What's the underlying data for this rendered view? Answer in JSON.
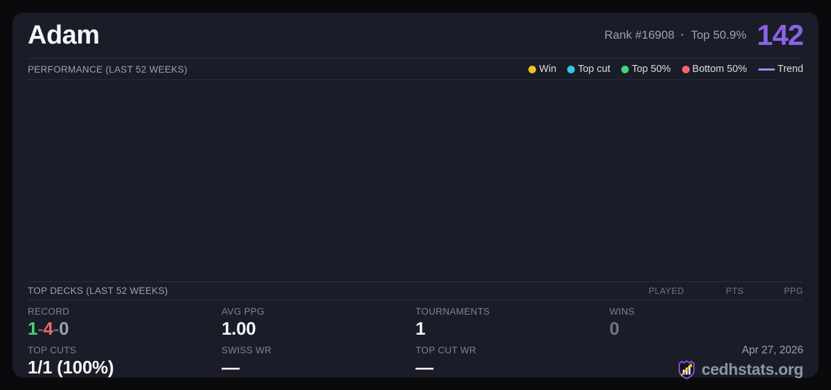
{
  "header": {
    "player_name": "Adam",
    "rank_label": "Rank #16908",
    "separator": "·",
    "percentile_label": "Top 50.9%",
    "score": "142"
  },
  "performance": {
    "section_title": "PERFORMANCE (LAST 52 WEEKS)",
    "legend": [
      {
        "label": "Win",
        "color": "#f2c21d",
        "marker": "dot"
      },
      {
        "label": "Top cut",
        "color": "#2bcce4",
        "marker": "dot"
      },
      {
        "label": "Top 50%",
        "color": "#3ed47c",
        "marker": "dot"
      },
      {
        "label": "Bottom 50%",
        "color": "#f1676d",
        "marker": "dot"
      },
      {
        "label": "Trend",
        "color": "#a78ef5",
        "marker": "line"
      }
    ]
  },
  "top_decks": {
    "section_title": "TOP DECKS (LAST 52 WEEKS)",
    "columns": [
      "PLAYED",
      "PTS",
      "PPG"
    ],
    "rows": []
  },
  "stats": {
    "record": {
      "label": "RECORD",
      "wins": "1",
      "losses": "4",
      "draws": "0",
      "dash": "-"
    },
    "avg_ppg": {
      "label": "AVG PPG",
      "value": "1.00"
    },
    "tournaments": {
      "label": "TOURNAMENTS",
      "value": "1"
    },
    "wins": {
      "label": "WINS",
      "value": "0"
    },
    "top_cuts": {
      "label": "TOP CUTS",
      "value": "1/1 (100%)"
    },
    "swiss_wr": {
      "label": "SWISS WR",
      "value": "—"
    },
    "top_cut_wr": {
      "label": "TOP CUT WR",
      "value": "—"
    }
  },
  "footer": {
    "date": "Apr 27, 2026",
    "brand": "cedhstats.org"
  },
  "colors": {
    "page_bg": "#0a0a0c",
    "card_bg": "#1a1d27",
    "divider": "#2c3040",
    "accent_purple": "#8a63e8",
    "trend_purple": "#a78ef5",
    "win_yellow": "#f2c21d",
    "top_cut_cyan": "#2bcce4",
    "top50_green": "#3ed47c",
    "bottom50_red": "#f1676d",
    "text_primary": "#f3f5f7",
    "text_muted": "#9aa3b2",
    "text_dim": "#6e7583"
  }
}
